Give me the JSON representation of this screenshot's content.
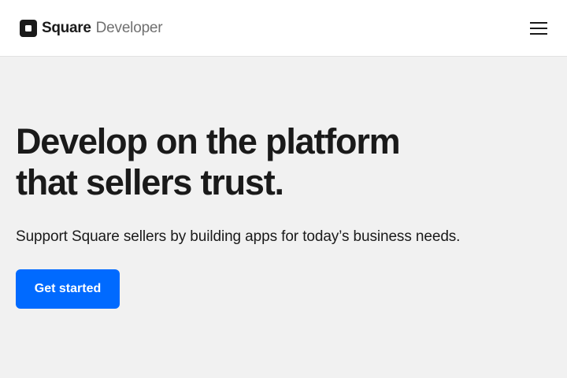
{
  "header": {
    "logo_brand": "Square",
    "logo_product": "Developer",
    "menu_icon": "hamburger-menu-icon"
  },
  "hero": {
    "title_line1": "Develop on the platform",
    "title_line2": "that sellers trust.",
    "subtitle": "Support Square sellers by building apps for today’s business needs.",
    "cta_label": "Get started"
  },
  "colors": {
    "background": "#f1f1f1",
    "header_background": "#ffffff",
    "text": "#1a1a1a",
    "muted_text": "#707070",
    "accent": "#006aff"
  }
}
